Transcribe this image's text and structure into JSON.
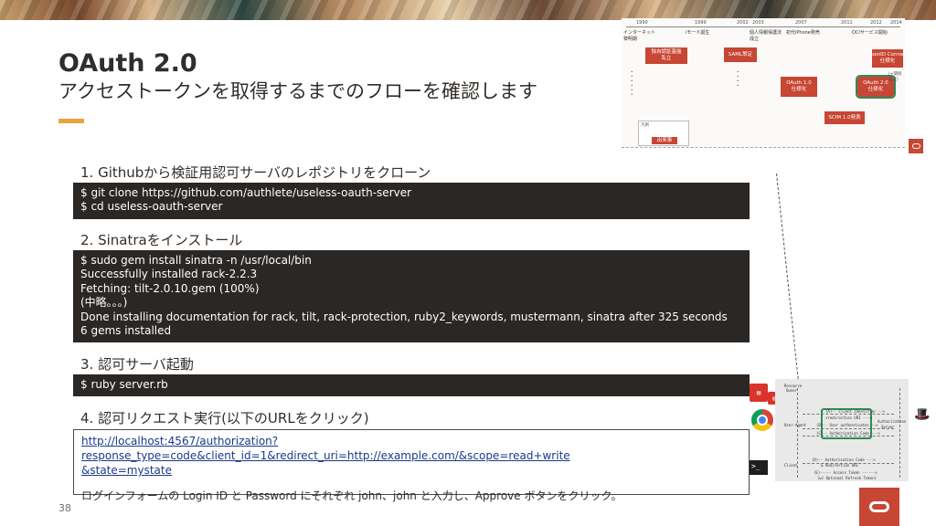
{
  "slide": {
    "title": "OAuth 2.0",
    "subtitle": "アクセストークンを取得するまでのフローを確認します",
    "page_number": "38"
  },
  "steps": [
    {
      "label": "1. Githubから検証用認可サーバのレポジトリをクローン",
      "code": [
        "$ git clone https://github.com/authlete/useless-oauth-server",
        "$ cd useless-oauth-server"
      ]
    },
    {
      "label": "2. Sinatraをインストール",
      "code": [
        "$ sudo gem install sinatra -n /usr/local/bin",
        "Successfully installed rack-2.2.3",
        "Fetching: tilt-2.0.10.gem (100%)",
        "(中略。。。)",
        "Done installing documentation for rack, tilt, rack-protection, ruby2_keywords, mustermann, sinatra after 325 seconds",
        "6 gems installed"
      ]
    },
    {
      "label": "3. 認可サーバ起動",
      "code": [
        "$ ruby server.rb"
      ]
    },
    {
      "label": "4. 認可リクエスト実行(以下のURLをクリック)",
      "url_line1": "http://localhost:4567/authorization?response_type=code&client_id=1&redirect_uri=http://example.com/&scope=read+write",
      "url_line2": "&state=mystate",
      "note": "ログインフォームの Login ID と Password にそれぞれ john、john と入力し、Approve ボタンをクリック。"
    }
  ],
  "timeline": {
    "years": [
      "1990",
      "1999",
      "2002",
      "2003",
      "2007",
      "2011",
      "2012",
      "2014"
    ],
    "events": [
      "インターネット\n黎明期",
      "iモード誕生",
      "個人情報保護法\n成立",
      "初代iPhone発売",
      "OCIサービス開始"
    ],
    "boxes": [
      "独自認証基盤\n乱立",
      "SAML策定",
      "OAuth 1.0\n仕様化",
      "OAuth 2.0\n仕様化",
      "OpenID Connect\n仕様化",
      "SCIM 1.0発表"
    ],
    "legend": "凡例",
    "legend_item": "出来事",
    "label_box": "(+関係認証)"
  },
  "sequence": {
    "lines": [
      "Resource",
      "Owner",
      "(A)-- Client Identifier -->",
      "<redirection URI ---+",
      "(B)-- User authenticates -->",
      "User-Agent",
      "Authorization",
      "Server",
      "(C)-- Authorization Code ---<",
      "(D)-- Authorization Code --->",
      "& Redirection URI",
      "Client",
      "(E)----- Access Token ------<",
      "(w/ Optional Refresh Token)"
    ]
  },
  "colors": {
    "accent": "#e8a33a",
    "oracle_red": "#c74634",
    "code_bg": "#2b2724"
  },
  "icons": [
    "server-icon",
    "chrome-icon",
    "terminal-icon",
    "hat-icon",
    "oracle-logo-icon"
  ]
}
